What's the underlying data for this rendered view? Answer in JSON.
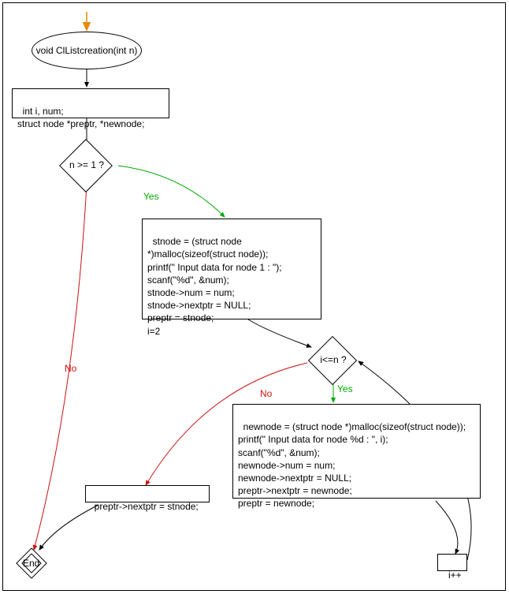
{
  "chart_data": {
    "type": "flowchart",
    "title": "void ClListcreation(int n)",
    "nodes": [
      {
        "id": "start_arrow",
        "type": "entry"
      },
      {
        "id": "start",
        "type": "terminator",
        "text": "void ClListcreation(int n)"
      },
      {
        "id": "decl",
        "type": "process",
        "text": "int i, num;\nstruct node *preptr, *newnode;"
      },
      {
        "id": "cond1",
        "type": "decision",
        "text": "n >= 1 ?"
      },
      {
        "id": "block1",
        "type": "process",
        "text": "stnode = (struct node *)malloc(sizeof(struct node));\nprintf(\" Input data for node 1 : \");\nscanf(\"%d\", &num);\nstnode->num = num;\nstnode->nextptr = NULL;\npreptr = stnode;\ni=2"
      },
      {
        "id": "cond2",
        "type": "decision",
        "text": "i<=n ?"
      },
      {
        "id": "block2",
        "type": "process",
        "text": "newnode = (struct node *)malloc(sizeof(struct node));\nprintf(\" Input data for node %d : \", i);\nscanf(\"%d\", &num);\nnewnode->num = num;\nnewnode->nextptr = NULL;\npreptr->nextptr = newnode;\npreptr = newnode;"
      },
      {
        "id": "inc",
        "type": "process",
        "text": "i++"
      },
      {
        "id": "assign",
        "type": "process",
        "text": "preptr->nextptr = stnode;"
      },
      {
        "id": "end",
        "type": "terminator",
        "text": "End"
      }
    ],
    "edges": [
      {
        "from": "start_arrow",
        "to": "start"
      },
      {
        "from": "start",
        "to": "decl"
      },
      {
        "from": "decl",
        "to": "cond1"
      },
      {
        "from": "cond1",
        "to": "block1",
        "label": "Yes"
      },
      {
        "from": "cond1",
        "to": "end",
        "label": "No"
      },
      {
        "from": "block1",
        "to": "cond2"
      },
      {
        "from": "cond2",
        "to": "block2",
        "label": "Yes"
      },
      {
        "from": "cond2",
        "to": "assign",
        "label": "No"
      },
      {
        "from": "block2",
        "to": "inc"
      },
      {
        "from": "inc",
        "to": "cond2"
      },
      {
        "from": "assign",
        "to": "end"
      }
    ]
  },
  "labels": {
    "yes": "Yes",
    "no": "No"
  }
}
